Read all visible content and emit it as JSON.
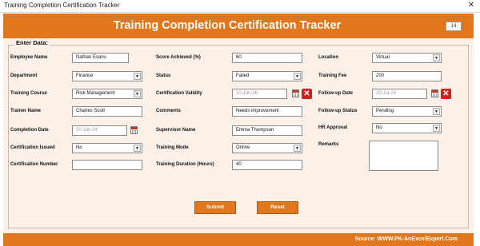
{
  "window": {
    "title": "Training Completion Certification Tracker",
    "close_label": "✕"
  },
  "header": {
    "title": "Training Completion Certification Tracker",
    "counter": "14"
  },
  "form": {
    "legend": "Enter Data:",
    "fields": {
      "employee_name": {
        "label": "Employee Name",
        "value": "Nathan Evans"
      },
      "department": {
        "label": "Department",
        "value": "Finance"
      },
      "training_course": {
        "label": "Training Course",
        "value": "Risk Management"
      },
      "trainer_name": {
        "label": "Trainer Name",
        "value": "Charles Scott"
      },
      "completion_date": {
        "label": "Completion Date",
        "value": "20-Jun-24"
      },
      "certification_issued": {
        "label": "Certification Issued",
        "value": "No"
      },
      "certification_number": {
        "label": "Certification Number",
        "value": ""
      },
      "score_achieved": {
        "label": "Score Achieved (%)",
        "value": "60"
      },
      "status": {
        "label": "Status",
        "value": "Failed"
      },
      "certification_validity": {
        "label": "Certification Validity",
        "value": "20-Jun-26"
      },
      "comments": {
        "label": "Comments",
        "value": "Needs improvement"
      },
      "supervisor_name": {
        "label": "Supervisor Name",
        "value": "Emma Thompson"
      },
      "training_mode": {
        "label": "Training Mode",
        "value": "Online"
      },
      "training_duration": {
        "label": "Training Duration (Hours)",
        "value": "40"
      },
      "location": {
        "label": "Location",
        "value": "Virtual"
      },
      "training_fee": {
        "label": "Training Fee",
        "value": "200"
      },
      "follow_up_date": {
        "label": "Follow-up Date",
        "value": "20-Jul-24"
      },
      "follow_up_status": {
        "label": "Follow-up Status",
        "value": "Pending"
      },
      "hr_approval": {
        "label": "HR Approval",
        "value": "No"
      },
      "remarks": {
        "label": "Remarks",
        "value": ""
      }
    },
    "dropdown_arrow": "▼",
    "clear_glyph": "✕"
  },
  "buttons": {
    "submit": "Submit",
    "reset": "Reset"
  },
  "footer": {
    "source": "Source: WWW.PK-AnExcelExpert.Com"
  },
  "colors": {
    "accent": "#e0761e",
    "panel": "#fbf1e8",
    "clear_red": "#d21f1f"
  }
}
